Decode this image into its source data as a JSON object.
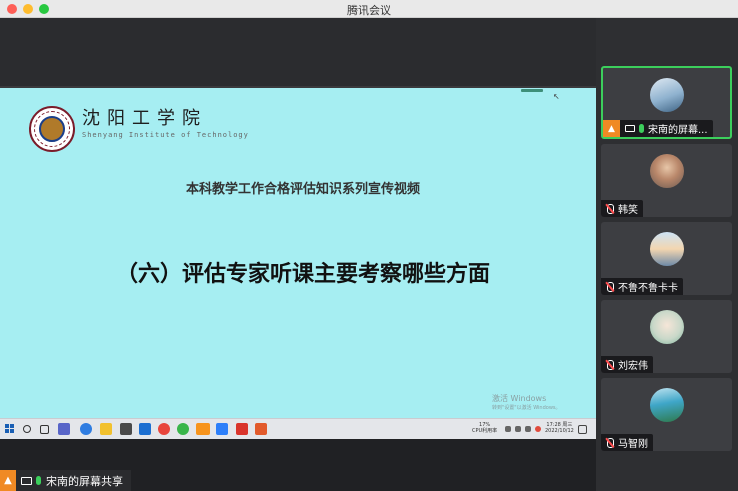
{
  "window": {
    "title": "腾讯会议"
  },
  "slide": {
    "school_name_cn": "沈阳工学院",
    "school_name_en": "Shenyang Institute of Technology",
    "subtitle": "本科教学工作合格评估知识系列宣传视频",
    "headline": "（六）评估专家听课主要考察哪些方面",
    "watermark_title": "激活 Windows",
    "watermark_sub": "转到\"设置\"以激活 Windows。",
    "background_color": "#a6eef2"
  },
  "taskbar": {
    "cpu": "17%",
    "cpu_label": "CPU利用率",
    "time": "17:28 周三",
    "date": "2022/10/12"
  },
  "share_label": {
    "text": "宋南的屏幕共享"
  },
  "participants": [
    {
      "name": "宋南的屏幕...",
      "sharing": true,
      "mic": "on",
      "active": true
    },
    {
      "name": "韩笑",
      "sharing": false,
      "mic": "muted",
      "active": false
    },
    {
      "name": "不鲁不鲁卡卡",
      "sharing": false,
      "mic": "muted",
      "active": false
    },
    {
      "name": "刘宏伟",
      "sharing": false,
      "mic": "muted",
      "active": false
    },
    {
      "name": "马智刚",
      "sharing": false,
      "mic": "muted",
      "active": false
    }
  ],
  "colors": {
    "accent_green": "#3ccf5c",
    "share_orange": "#f08a24"
  }
}
